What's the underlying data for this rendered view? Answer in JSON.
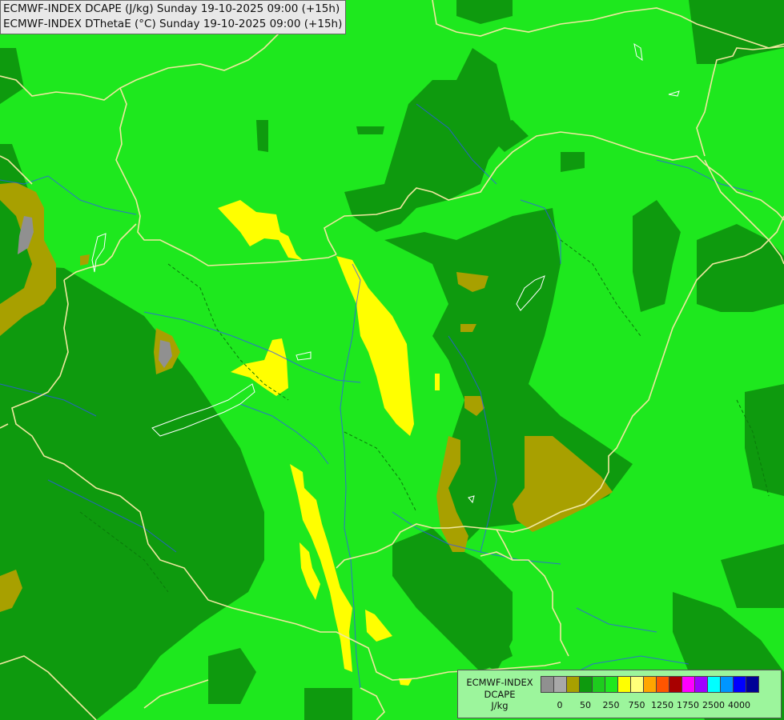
{
  "header": {
    "line1": "ECMWF-INDEX DCAPE (J/kg) Sunday 19-10-2025 09:00 (+15h)",
    "line2": "ECMWF-INDEX DThetaE (°C) Sunday 19-10-2025 09:00 (+15h)"
  },
  "legend": {
    "line1": "ECMWF-INDEX",
    "line2": "DCAPE",
    "line3": "J/kg",
    "colors": [
      "#909090",
      "#a8a8a8",
      "#a8a000",
      "#0e9a0e",
      "#1ecc1e",
      "#1ee81e",
      "#ffff00",
      "#ffff7a",
      "#ffa500",
      "#ff5500",
      "#a80000",
      "#ff00ff",
      "#a000ff",
      "#00ffff",
      "#0096ff",
      "#0000ff",
      "#000096"
    ],
    "ticks": [
      {
        "label": "0",
        "index": 1
      },
      {
        "label": "50",
        "index": 3
      },
      {
        "label": "250",
        "index": 5
      },
      {
        "label": "750",
        "index": 7
      },
      {
        "label": "1250",
        "index": 9
      },
      {
        "label": "1750",
        "index": 11
      },
      {
        "label": "2500",
        "index": 13
      },
      {
        "label": "4000",
        "index": 15
      }
    ]
  }
}
